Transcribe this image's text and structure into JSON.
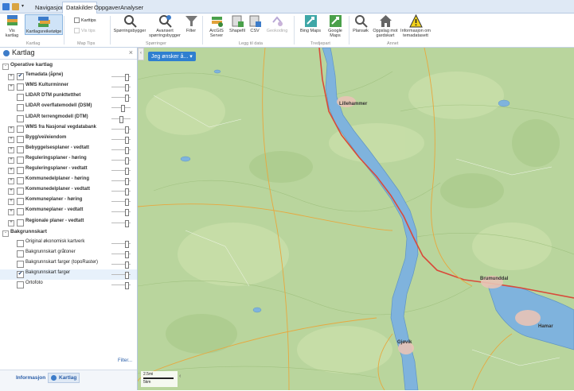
{
  "tabs": [
    "Navigasjon",
    "Datakilder",
    "Oppgaver",
    "Analyser"
  ],
  "active_tab": "Datakilder",
  "ribbon": {
    "buttons": [
      {
        "label": "Vis\nkartlag",
        "icon": "layers-icon"
      },
      {
        "label": "Kartlagsreiketølge",
        "icon": "layer-stack-icon"
      },
      {
        "label": "Spørringsbygger",
        "icon": "query-icon"
      },
      {
        "label": "Avansert\nspørringsbygger",
        "icon": "advanced-query-icon"
      },
      {
        "label": "Filter",
        "icon": "filter-icon"
      },
      {
        "label": "ArcGIS\nServer",
        "icon": "arcgis-icon"
      },
      {
        "label": "Shapefil",
        "icon": "shapefile-icon"
      },
      {
        "label": "CSV",
        "icon": "csv-icon"
      },
      {
        "label": "Geokoding",
        "icon": "geocode-icon"
      },
      {
        "label": "Bing Maps",
        "icon": "bing-icon"
      },
      {
        "label": "Google\nMaps",
        "icon": "google-icon"
      },
      {
        "label": "Plansøk",
        "icon": "search-icon"
      },
      {
        "label": "Oppslag mot\ngardskart",
        "icon": "house-icon"
      },
      {
        "label": "Informasjon om\ntemadatasett",
        "icon": "warning-icon"
      }
    ],
    "checkboxes": [
      "Karttips",
      "Vis tips"
    ],
    "groups": [
      "Kartlag",
      "Map Tips",
      "Spørringer",
      "Legg til data",
      "Tredjepart",
      "Annet"
    ]
  },
  "panel": {
    "title": "Kartlag",
    "close": "×",
    "filter_link": "Filter...",
    "bottom_tabs": [
      "Informasjon",
      "Kartlag"
    ],
    "rows": [
      {
        "label": "Operative kartlag",
        "group": true,
        "expander": "-"
      },
      {
        "label": "Temadata (åpne)",
        "expander": "+",
        "checked": true,
        "bold": true
      },
      {
        "label": "WMS Kulturminner",
        "expander": "+",
        "checked": false,
        "bold": true
      },
      {
        "label": "LIDAR DTM punkttetthet",
        "expander": "",
        "checked": false,
        "bold": true
      },
      {
        "label": "LIDAR overflatemodell (DSM)",
        "expander": "",
        "checked": false,
        "bold": true
      },
      {
        "label": "LIDAR terrengmodell (DTM)",
        "expander": "",
        "checked": false,
        "bold": true
      },
      {
        "label": "WMS fra Nasjonal vegdatabank",
        "expander": "+",
        "checked": false,
        "bold": true
      },
      {
        "label": "Bygg/vei/eiendom",
        "expander": "+",
        "checked": false,
        "bold": true
      },
      {
        "label": "Bebyggelsesplaner - vedtatt",
        "expander": "+",
        "checked": false,
        "bold": true
      },
      {
        "label": "Reguleringsplaner - høring",
        "expander": "+",
        "checked": false,
        "bold": true
      },
      {
        "label": "Reguleringsplaner - vedtatt",
        "expander": "+",
        "checked": false,
        "bold": true
      },
      {
        "label": "Kommunedelplaner - høring",
        "expander": "+",
        "checked": false,
        "bold": true
      },
      {
        "label": "Kommunedelplaner - vedtatt",
        "expander": "+",
        "checked": false,
        "bold": true
      },
      {
        "label": "Kommuneplaner - høring",
        "expander": "+",
        "checked": false,
        "bold": true
      },
      {
        "label": "Kommuneplaner - vedtatt",
        "expander": "+",
        "checked": false,
        "bold": true
      },
      {
        "label": "Regionale planer - vedtatt",
        "expander": "+",
        "checked": false,
        "bold": true
      },
      {
        "label": "Bakgrunnskart",
        "group": true,
        "expander": "-"
      },
      {
        "label": "Original økonomisk kartverk",
        "expander": "",
        "checked": false,
        "bold": false
      },
      {
        "label": "Bakgrunnskart gråtoner",
        "expander": "",
        "checked": false,
        "bold": false
      },
      {
        "label": "Bakgrunnskart farger (topoRaster)",
        "expander": "",
        "checked": false,
        "bold": false
      },
      {
        "label": "Bakgrunnskart farger",
        "expander": "",
        "checked": true,
        "bold": false,
        "highlight": true
      },
      {
        "label": "Ortofoto",
        "expander": "",
        "checked": false,
        "bold": false
      }
    ]
  },
  "map": {
    "dropdown": "Jeg ønsker å... ▾",
    "towns": [
      "Lillehammer",
      "Brumunddal",
      "Hamar",
      "Gjøvik"
    ],
    "scale_top": "2.5mi",
    "scale_bottom": "5km",
    "colors": {
      "land": "#b9d59d",
      "water": "#7fb3dd",
      "road": "#d94a3a"
    }
  }
}
